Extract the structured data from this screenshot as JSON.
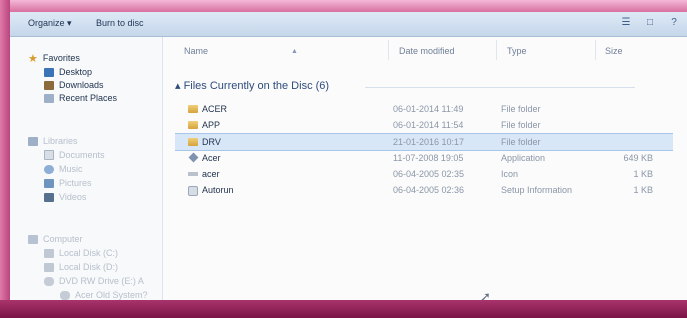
{
  "toolbar": {
    "organize_label": "Organize ▾",
    "burn_label": "Burn to disc"
  },
  "sidebar": {
    "favorites": [
      {
        "label": "Favorites",
        "icon": "star-icon"
      },
      {
        "label": "Desktop",
        "icon": "desktop-icon"
      },
      {
        "label": "Downloads",
        "icon": "downloads-icon"
      },
      {
        "label": "Recent Places",
        "icon": "recent-places-icon"
      }
    ],
    "libraries": [
      {
        "label": "Libraries",
        "icon": "libraries-icon"
      },
      {
        "label": "Documents",
        "icon": "documents-icon"
      },
      {
        "label": "Music",
        "icon": "music-icon"
      },
      {
        "label": "Pictures",
        "icon": "pictures-icon"
      },
      {
        "label": "Videos",
        "icon": "videos-icon"
      }
    ],
    "computer": [
      {
        "label": "Computer",
        "icon": "computer-icon"
      },
      {
        "label": "Local Disk (C:)",
        "icon": "disk-icon"
      },
      {
        "label": "Local Disk (D:)",
        "icon": "disk-icon"
      },
      {
        "label": "DVD RW Drive (E:) A",
        "icon": "dvd-icon"
      },
      {
        "label": "Acer Old System?",
        "icon": "dvd-icon"
      }
    ]
  },
  "columns": {
    "name": "Name",
    "date": "Date modified",
    "type": "Type",
    "size": "Size"
  },
  "group_label": "Files Currently on the Disc (6)",
  "files": [
    {
      "name": "ACER",
      "date": "06-01-2014 11:49",
      "type": "File folder",
      "size": "",
      "icon": "folder-icon"
    },
    {
      "name": "APP",
      "date": "06-01-2014 11:54",
      "type": "File folder",
      "size": "",
      "icon": "folder-icon"
    },
    {
      "name": "DRV",
      "date": "21-01-2016 10:17",
      "type": "File folder",
      "size": "",
      "icon": "folder-icon"
    },
    {
      "name": "Acer",
      "date": "11-07-2008 19:05",
      "type": "Application",
      "size": "649 KB",
      "icon": "application-icon"
    },
    {
      "name": "acer",
      "date": "06-04-2005 02:35",
      "type": "Icon",
      "size": "1 KB",
      "icon": "ico-icon"
    },
    {
      "name": "Autorun",
      "date": "06-04-2005 02:36",
      "type": "Setup Information",
      "size": "1 KB",
      "icon": "setup-information-icon"
    }
  ],
  "selected_file": "DRV"
}
